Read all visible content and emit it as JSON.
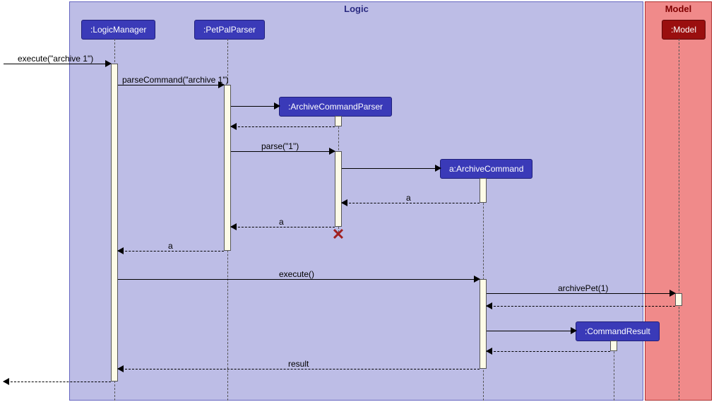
{
  "frames": {
    "logic": {
      "label": "Logic"
    },
    "model": {
      "label": "Model"
    }
  },
  "participants": {
    "logicManager": ":LogicManager",
    "petPalParser": ":PetPalParser",
    "archiveCommandParser": ":ArchiveCommandParser",
    "archiveCommand": "a:ArchiveCommand",
    "commandResult": ":CommandResult",
    "model": ":Model"
  },
  "messages": {
    "execute1": "execute(\"archive 1\")",
    "parseCommand": "parseCommand(\"archive 1\")",
    "parse1": "parse(\"1\")",
    "returnA1": "a",
    "returnA2": "a",
    "returnA3": "a",
    "executeEmpty": "execute()",
    "archivePet": "archivePet(1)",
    "result": "result"
  },
  "chart_data": {
    "type": "sequence-diagram",
    "frames": [
      {
        "name": "Logic",
        "contains": [
          ":LogicManager",
          ":PetPalParser",
          ":ArchiveCommandParser",
          "a:ArchiveCommand",
          ":CommandResult"
        ]
      },
      {
        "name": "Model",
        "contains": [
          ":Model"
        ]
      }
    ],
    "participants": [
      ":LogicManager",
      ":PetPalParser",
      ":ArchiveCommandParser",
      "a:ArchiveCommand",
      ":CommandResult",
      ":Model"
    ],
    "interactions": [
      {
        "from": "external",
        "to": ":LogicManager",
        "label": "execute(\"archive 1\")",
        "type": "call"
      },
      {
        "from": ":LogicManager",
        "to": ":PetPalParser",
        "label": "parseCommand(\"archive 1\")",
        "type": "call"
      },
      {
        "from": ":PetPalParser",
        "to": ":ArchiveCommandParser",
        "label": "",
        "type": "create"
      },
      {
        "from": ":ArchiveCommandParser",
        "to": ":PetPalParser",
        "label": "",
        "type": "return"
      },
      {
        "from": ":PetPalParser",
        "to": ":ArchiveCommandParser",
        "label": "parse(\"1\")",
        "type": "call"
      },
      {
        "from": ":ArchiveCommandParser",
        "to": "a:ArchiveCommand",
        "label": "",
        "type": "create"
      },
      {
        "from": "a:ArchiveCommand",
        "to": ":ArchiveCommandParser",
        "label": "a",
        "type": "return"
      },
      {
        "from": ":ArchiveCommandParser",
        "to": ":PetPalParser",
        "label": "a",
        "type": "return"
      },
      {
        "from": ":ArchiveCommandParser",
        "to": "",
        "label": "",
        "type": "destroy"
      },
      {
        "from": ":PetPalParser",
        "to": ":LogicManager",
        "label": "a",
        "type": "return"
      },
      {
        "from": ":LogicManager",
        "to": "a:ArchiveCommand",
        "label": "execute()",
        "type": "call"
      },
      {
        "from": "a:ArchiveCommand",
        "to": ":Model",
        "label": "archivePet(1)",
        "type": "call"
      },
      {
        "from": ":Model",
        "to": "a:ArchiveCommand",
        "label": "",
        "type": "return"
      },
      {
        "from": "a:ArchiveCommand",
        "to": ":CommandResult",
        "label": "",
        "type": "create"
      },
      {
        "from": ":CommandResult",
        "to": "a:ArchiveCommand",
        "label": "",
        "type": "return"
      },
      {
        "from": "a:ArchiveCommand",
        "to": ":LogicManager",
        "label": "result",
        "type": "return"
      },
      {
        "from": ":LogicManager",
        "to": "external",
        "label": "",
        "type": "return"
      }
    ]
  }
}
